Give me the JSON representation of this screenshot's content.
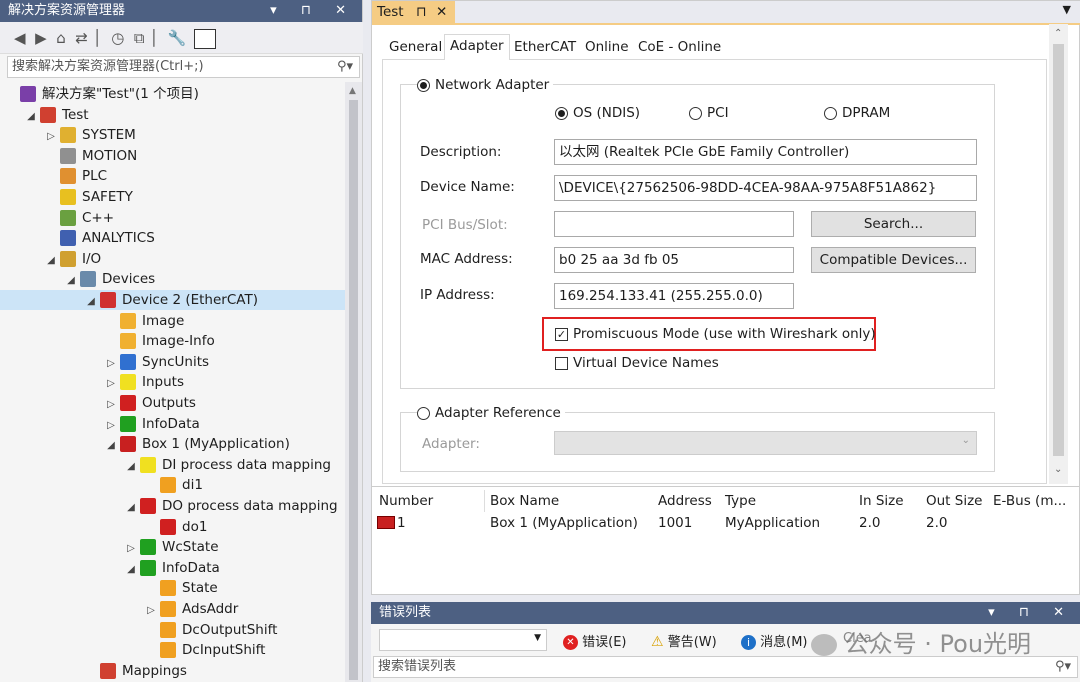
{
  "explorer": {
    "title": "解决方案资源管理器",
    "title_buttons": "▾ ⊓ ✕",
    "search_placeholder": "搜索解决方案资源管理器(Ctrl+;)",
    "tree": [
      {
        "label": "解决方案\"Test\"(1 个项目)",
        "icon": "solution-icon"
      },
      {
        "label": "Test",
        "icon": "project-icon"
      },
      {
        "label": "SYSTEM",
        "icon": "system-icon"
      },
      {
        "label": "MOTION",
        "icon": "motion-icon"
      },
      {
        "label": "PLC",
        "icon": "plc-icon"
      },
      {
        "label": "SAFETY",
        "icon": "safety-icon"
      },
      {
        "label": "C++",
        "icon": "cpp-icon"
      },
      {
        "label": "ANALYTICS",
        "icon": "analytics-icon"
      },
      {
        "label": "I/O",
        "icon": "io-icon"
      },
      {
        "label": "Devices",
        "icon": "devices-icon"
      },
      {
        "label": "Device 2 (EtherCAT)",
        "icon": "ethercat-device-icon"
      },
      {
        "label": "Image",
        "icon": "image-icon"
      },
      {
        "label": "Image-Info",
        "icon": "image-info-icon"
      },
      {
        "label": "SyncUnits",
        "icon": "syncunits-icon"
      },
      {
        "label": "Inputs",
        "icon": "inputs-icon"
      },
      {
        "label": "Outputs",
        "icon": "outputs-icon"
      },
      {
        "label": "InfoData",
        "icon": "infodata-icon"
      },
      {
        "label": "Box 1 (MyApplication)",
        "icon": "box-icon"
      },
      {
        "label": "DI process data mapping",
        "icon": "di-mapping-icon"
      },
      {
        "label": "di1",
        "icon": "variable-in-icon"
      },
      {
        "label": "DO process data mapping",
        "icon": "do-mapping-icon"
      },
      {
        "label": "do1",
        "icon": "variable-out-icon"
      },
      {
        "label": "WcState",
        "icon": "wcstate-icon"
      },
      {
        "label": "InfoData",
        "icon": "infodata-icon"
      },
      {
        "label": "State",
        "icon": "variable-in-icon"
      },
      {
        "label": "AdsAddr",
        "icon": "variable-in-icon"
      },
      {
        "label": "DcOutputShift",
        "icon": "variable-in-icon"
      },
      {
        "label": "DcInputShift",
        "icon": "variable-in-icon"
      },
      {
        "label": "Mappings",
        "icon": "mappings-icon"
      }
    ]
  },
  "doc": {
    "tab": "Test",
    "tab_pin": "⊓",
    "tab_close": "✕",
    "tabs": [
      "General",
      "Adapter",
      "EtherCAT",
      "Online",
      "CoE - Online"
    ],
    "network_adapter": "Network Adapter",
    "os_ndis": "OS (NDIS)",
    "pci": "PCI",
    "dpram": "DPRAM",
    "description_label": "Description:",
    "description_value": "以太网 (Realtek PCIe GbE Family Controller)",
    "device_name_label": "Device Name:",
    "device_name_value": "\\DEVICE\\{27562506-98DD-4CEA-98AA-975A8F51A862}",
    "pci_label": "PCI Bus/Slot:",
    "pci_value": "",
    "search_button": "Search...",
    "mac_label": "MAC Address:",
    "mac_value": "b0 25 aa 3d fb 05",
    "compatible_button": "Compatible Devices...",
    "ip_label": "IP Address:",
    "ip_value": "169.254.133.41 (255.255.0.0)",
    "promiscuous": "Promiscuous Mode (use with Wireshark only)",
    "virtual_names": "Virtual Device Names",
    "adapter_reference": "Adapter Reference",
    "adapter_label": "Adapter:"
  },
  "table": {
    "headers": [
      "Number",
      "Box Name",
      "Address",
      "Type",
      "In Size",
      "Out Size",
      "E-Bus (m..."
    ],
    "row": [
      "1",
      "Box 1 (MyApplication)",
      "1001",
      "MyApplication",
      "2.0",
      "2.0",
      ""
    ]
  },
  "errors": {
    "title": "错误列表",
    "title_buttons": "▾ ⊓ ✕",
    "error_label": "错误(E)",
    "warning_label": "警告(W)",
    "message_label": "消息(M)",
    "search_placeholder": "搜索错误列表",
    "watermark": "公众号 · Pou光明",
    "extra": "Clea"
  },
  "colors": {
    "titlebar": "#4d6082",
    "selected": "#cce4f7",
    "highlight_box": "#e02020"
  }
}
